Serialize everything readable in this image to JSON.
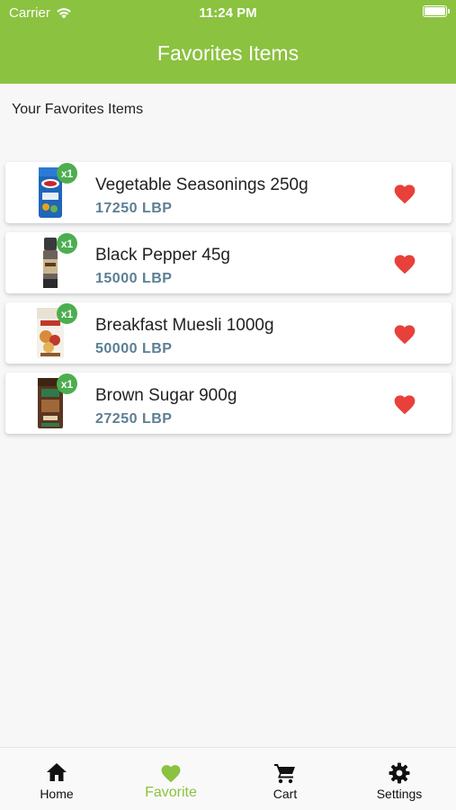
{
  "status_bar": {
    "carrier": "Carrier",
    "time": "11:24 PM"
  },
  "header": {
    "title": "Favorites Items"
  },
  "subtitle": "Your Favorites Items",
  "items": [
    {
      "name": "Vegetable Seasonings 250g",
      "price": "17250 LBP",
      "qty": "x1",
      "image": "seasoning-pack-image"
    },
    {
      "name": "Black Pepper 45g",
      "price": "15000 LBP",
      "qty": "x1",
      "image": "pepper-grinder-image"
    },
    {
      "name": "Breakfast Muesli 1000g",
      "price": "50000 LBP",
      "qty": "x1",
      "image": "muesli-bag-image"
    },
    {
      "name": "Brown Sugar 900g",
      "price": "27250 LBP",
      "qty": "x1",
      "image": "sugar-bag-image"
    }
  ],
  "tabs": [
    {
      "label": "Home",
      "icon": "home-icon"
    },
    {
      "label": "Favorite",
      "icon": "heart-icon",
      "active": true
    },
    {
      "label": "Cart",
      "icon": "cart-icon"
    },
    {
      "label": "Settings",
      "icon": "gear-icon"
    }
  ],
  "colors": {
    "brand_green": "#8bc23f",
    "badge_green": "#4cae4f",
    "heart_red": "#e8403a",
    "price_slate": "#5c7f93"
  }
}
